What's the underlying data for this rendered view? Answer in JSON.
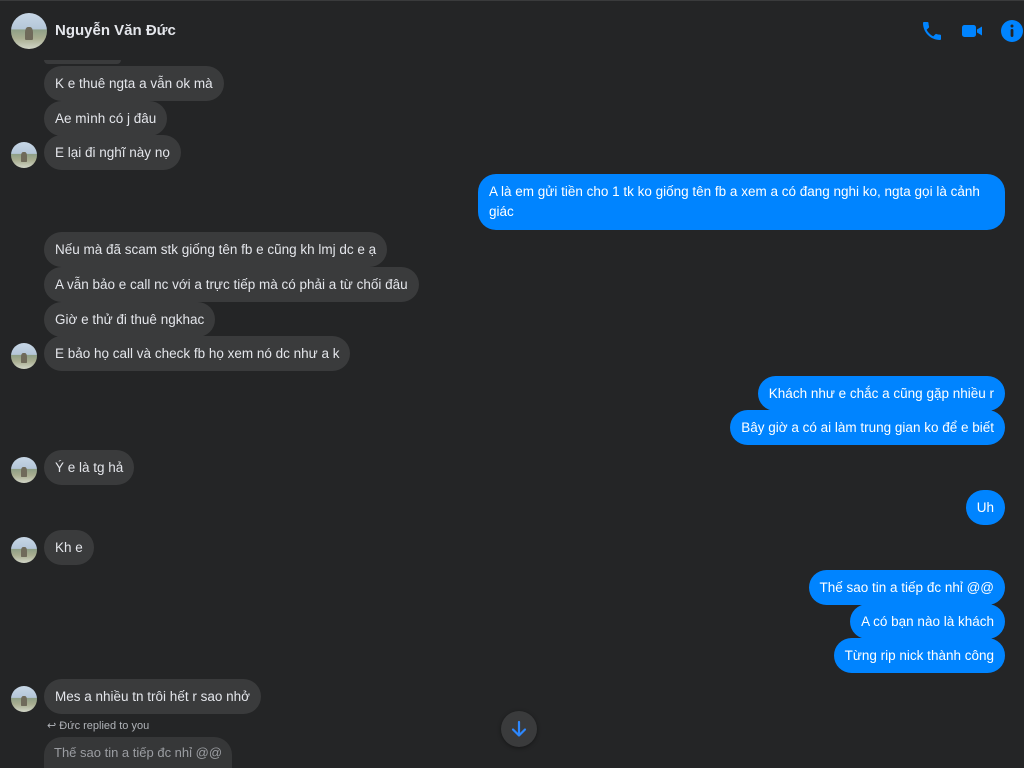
{
  "header": {
    "contact_name": "Nguyễn Văn Đức",
    "icons": [
      "phone-icon",
      "video-camera-icon",
      "info-icon"
    ],
    "accent_color": "#0084ff"
  },
  "messages": [
    {
      "dir": "in",
      "text": "K e thuê ngta a vẫn ok mà"
    },
    {
      "dir": "in",
      "text": "Ae mình có j đâu"
    },
    {
      "dir": "in",
      "text": "E lại đi nghĩ này nọ"
    },
    {
      "dir": "out",
      "text": "A là em gửi tiền cho 1 tk ko giống tên fb a xem a có đang nghi ko, ngta gọi là cảnh giác"
    },
    {
      "dir": "in",
      "text": "Nếu mà đã scam stk giống tên fb e cũng kh lmj dc e ạ"
    },
    {
      "dir": "in",
      "text": "A vẫn bảo e call nc với a trực tiếp mà có phải a từ chối đâu"
    },
    {
      "dir": "in",
      "text": "Giờ e thử đi thuê ngkhac"
    },
    {
      "dir": "in",
      "text": "E bảo họ call và check fb họ xem nó dc như a k"
    },
    {
      "dir": "out",
      "text": "Khách như e chắc a cũng gặp nhiều r"
    },
    {
      "dir": "out",
      "text": "Bây giờ a có ai làm trung gian ko để e biết"
    },
    {
      "dir": "in",
      "text": "Ý e là tg hả"
    },
    {
      "dir": "out",
      "text": "Uh"
    },
    {
      "dir": "in",
      "text": "Kh e"
    },
    {
      "dir": "out",
      "text": "Thế sao tin a tiếp đc nhỉ @@"
    },
    {
      "dir": "out",
      "text": "A có bạn nào là khách"
    },
    {
      "dir": "out",
      "text": "Từng rip nick thành công"
    },
    {
      "dir": "in",
      "text": "Mes a nhiều tn trôi hết r sao nhở"
    }
  ],
  "reply": {
    "note": "Đức replied to you",
    "quoted_text": "Thế sao tin a tiếp đc nhỉ @@"
  },
  "scroll_down_icon": "arrow-down-icon"
}
